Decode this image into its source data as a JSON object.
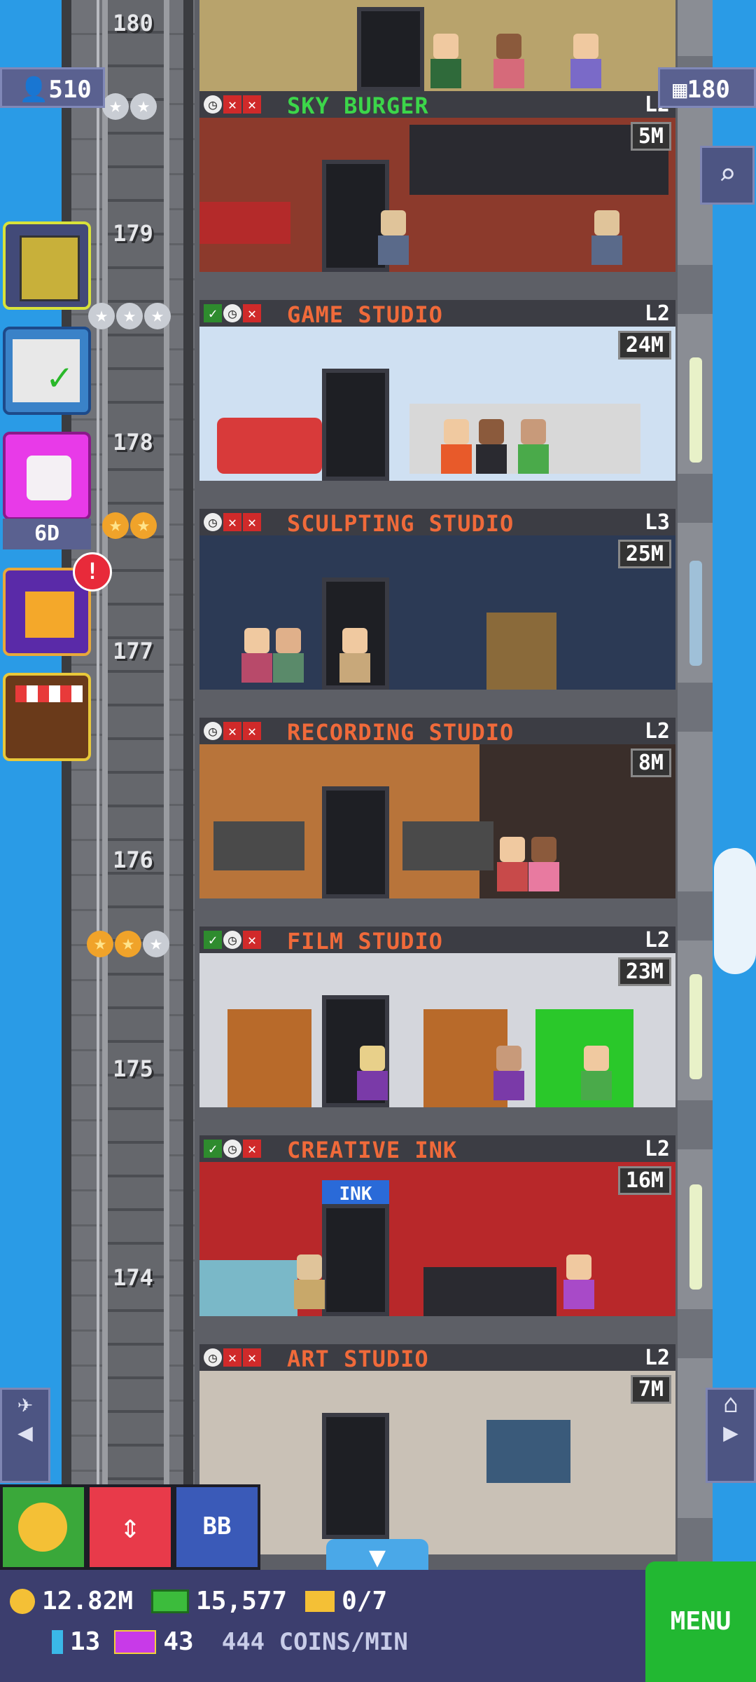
{
  "floors": [
    {
      "number": "180",
      "name": "",
      "level": "",
      "price": ""
    },
    {
      "number": "179",
      "name": "SKY BURGER",
      "name_color": "#3cd64a",
      "level": "L2",
      "price": "5M",
      "stars": [
        "silver",
        "silver"
      ],
      "check": false
    },
    {
      "number": "178",
      "name": "GAME STUDIO",
      "name_color": "#f06a3a",
      "level": "L2",
      "price": "24M",
      "stars": [
        "silver",
        "silver",
        "silver"
      ],
      "check": true
    },
    {
      "number": "177",
      "name": "SCULPTING STUDIO",
      "name_color": "#f06a3a",
      "level": "L3",
      "price": "25M",
      "stars": [
        "gold",
        "gold"
      ],
      "check": false
    },
    {
      "number": "176",
      "name": "RECORDING STUDIO",
      "name_color": "#f06a3a",
      "level": "L2",
      "price": "8M",
      "stars": [],
      "check": false
    },
    {
      "number": "175",
      "name": "FILM STUDIO",
      "name_color": "#f06a3a",
      "level": "L2",
      "price": "23M",
      "stars": [
        "gold",
        "gold",
        "silver"
      ],
      "check": true
    },
    {
      "number": "174",
      "name": "CREATIVE INK",
      "name_color": "#f06a3a",
      "level": "L2",
      "price": "16M",
      "stars": [],
      "check": true
    },
    {
      "number": "",
      "name": "ART STUDIO",
      "name_color": "#f06a3a",
      "level": "L2",
      "price": "7M",
      "stars": [],
      "check": false
    }
  ],
  "top_stats": {
    "population": "510",
    "floors_count": "180"
  },
  "side_buttons": {
    "dice_label": "6D"
  },
  "hud": {
    "coins": "12.82M",
    "bux": "15,577",
    "tickets": "0/7",
    "keys": "13",
    "golden": "43",
    "rate": "444 COINS/MIN",
    "menu": "MENU",
    "bb": "BB"
  },
  "colors": {
    "sky": "#2a9be6",
    "hud": "#3c3e6e",
    "menu": "#22b832"
  }
}
